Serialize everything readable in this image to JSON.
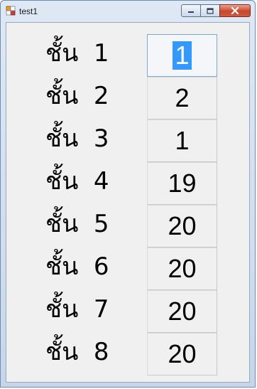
{
  "window": {
    "title": "test1"
  },
  "rows": [
    {
      "label": "ชั้น  1",
      "value": "1"
    },
    {
      "label": "ชั้น  2",
      "value": "2"
    },
    {
      "label": "ชั้น  3",
      "value": "1"
    },
    {
      "label": "ชั้น  4",
      "value": "19"
    },
    {
      "label": "ชั้น  5",
      "value": "20"
    },
    {
      "label": "ชั้น  6",
      "value": "20"
    },
    {
      "label": "ชั้น  7",
      "value": "20"
    },
    {
      "label": "ชั้น  8",
      "value": "20"
    }
  ],
  "colors": {
    "selection": "#3399ff",
    "close_button": "#c9462c",
    "client_bg": "#f0f0f0"
  },
  "icons": {
    "app": "app-icon",
    "minimize": "minimize-icon",
    "maximize": "maximize-icon",
    "close": "close-icon"
  }
}
